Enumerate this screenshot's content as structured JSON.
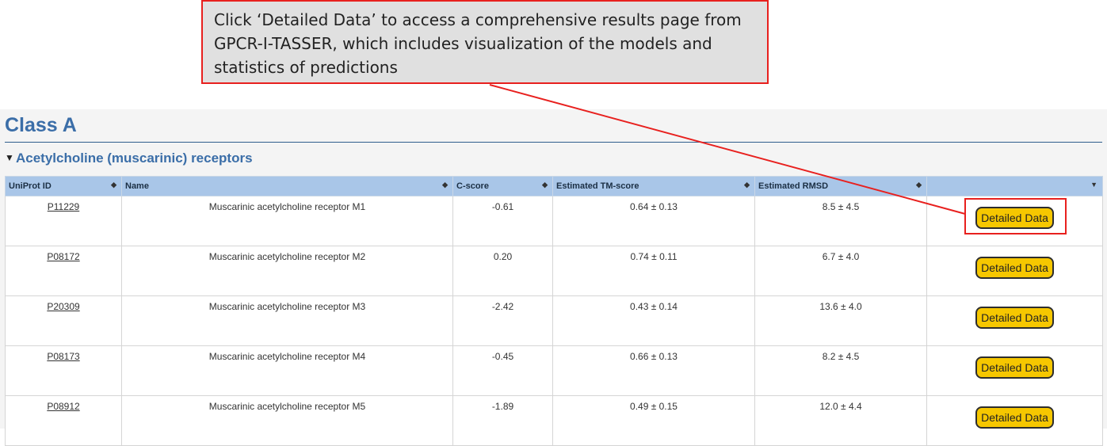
{
  "callout": {
    "lines": [
      "Click ‘Detailed Data’ to access a comprehensive results page from",
      "GPCR-I-TASSER, which includes visualization of the models and",
      "statistics of predictions"
    ]
  },
  "page": {
    "class_title": "Class A",
    "group_heading": "Acetylcholine (muscarinic) receptors",
    "table": {
      "headers": [
        "UniProt ID",
        "Name",
        "C-score",
        "Estimated TM-score",
        "Estimated RMSD",
        ""
      ],
      "button_label": "Detailed Data",
      "rows": [
        {
          "id": "P11229",
          "name": "Muscarinic acetylcholine receptor M1",
          "cscore": "-0.61",
          "tm": "0.64 ± 0.13",
          "rmsd": "8.5 ± 4.5"
        },
        {
          "id": "P08172",
          "name": "Muscarinic acetylcholine receptor M2",
          "cscore": "0.20",
          "tm": "0.74 ± 0.11",
          "rmsd": "6.7 ± 4.0"
        },
        {
          "id": "P20309",
          "name": "Muscarinic acetylcholine receptor M3",
          "cscore": "-2.42",
          "tm": "0.43 ± 0.14",
          "rmsd": "13.6 ± 4.0"
        },
        {
          "id": "P08173",
          "name": "Muscarinic acetylcholine receptor M4",
          "cscore": "-0.45",
          "tm": "0.66 ± 0.13",
          "rmsd": "8.2 ± 4.5"
        },
        {
          "id": "P08912",
          "name": "Muscarinic acetylcholine receptor M5",
          "cscore": "-1.89",
          "tm": "0.49 ± 0.15",
          "rmsd": "12.0 ± 4.4"
        }
      ]
    }
  },
  "icons": {
    "sort": "sort-icon",
    "dropdown": "chevron-down-icon",
    "collapse": "triangle-down-icon"
  },
  "colors": {
    "heading": "#3b6ea8",
    "header_bg": "#a9c6e8",
    "button": "#f6c700",
    "annotation": "#e8201e"
  }
}
